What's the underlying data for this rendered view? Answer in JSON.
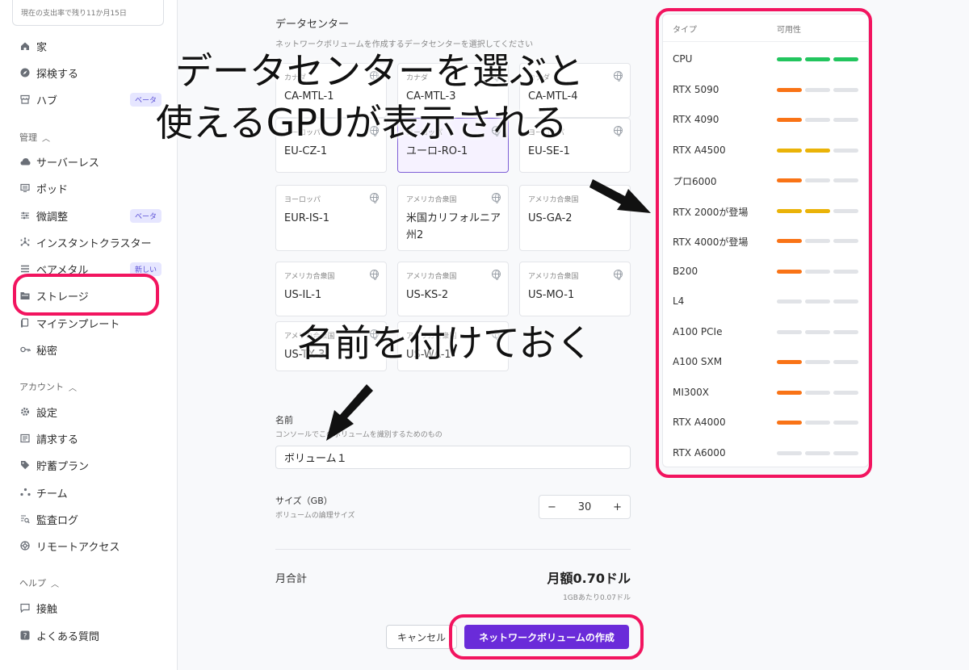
{
  "sidebar": {
    "spend_text": "現在の支出率で残り11か月15日",
    "items": [
      {
        "icon": "home-icon",
        "label": "家",
        "badge": ""
      },
      {
        "icon": "compass-icon",
        "label": "探検する",
        "badge": ""
      },
      {
        "icon": "store-icon",
        "label": "ハブ",
        "badge": "ベータ"
      },
      {
        "icon": "cloud-icon",
        "label": "サーバーレス",
        "badge": ""
      },
      {
        "icon": "monitor-icon",
        "label": "ポッド",
        "badge": ""
      },
      {
        "icon": "sliders-icon",
        "label": "微調整",
        "badge": "ベータ"
      },
      {
        "icon": "cluster-icon",
        "label": "インスタントクラスター",
        "badge": ""
      },
      {
        "icon": "list-icon",
        "label": "ベアメタル",
        "badge": "新しい"
      },
      {
        "icon": "folder-icon",
        "label": "ストレージ",
        "badge": ""
      },
      {
        "icon": "template-icon",
        "label": "マイテンプレート",
        "badge": ""
      },
      {
        "icon": "key-icon",
        "label": "秘密",
        "badge": ""
      },
      {
        "icon": "gear-icon",
        "label": "設定",
        "badge": ""
      },
      {
        "icon": "billing-icon",
        "label": "請求する",
        "badge": ""
      },
      {
        "icon": "tag-icon",
        "label": "貯蓄プラン",
        "badge": ""
      },
      {
        "icon": "team-icon",
        "label": "チーム",
        "badge": ""
      },
      {
        "icon": "audit-icon",
        "label": "監査ログ",
        "badge": ""
      },
      {
        "icon": "remote-icon",
        "label": "リモートアクセス",
        "badge": ""
      },
      {
        "icon": "chat-icon",
        "label": "接触",
        "badge": ""
      },
      {
        "icon": "question-icon",
        "label": "よくある質問",
        "badge": ""
      }
    ],
    "sections": [
      "管理",
      "アカウント",
      "ヘルプ"
    ]
  },
  "main": {
    "title": "データセンター",
    "subtitle": "ネットワークボリュームを作成するデータセンターを選択してください",
    "datacenters": [
      {
        "region": "カナダ",
        "code": "CA-MTL-1",
        "selected": false
      },
      {
        "region": "カナダ",
        "code": "CA-MTL-3",
        "selected": false
      },
      {
        "region": "カナダ",
        "code": "CA-MTL-4",
        "selected": false
      },
      {
        "region": "ヨーロッパ",
        "code": "EU-CZ-1",
        "selected": false
      },
      {
        "region": "ヨーロッパ",
        "code": "ユーロ-RO-1",
        "selected": true
      },
      {
        "region": "ヨーロッパ",
        "code": "EU-SE-1",
        "selected": false
      },
      {
        "region": "ヨーロッパ",
        "code": "EUR-IS-1",
        "selected": false
      },
      {
        "region": "アメリカ合衆国",
        "code": "米国カリフォルニア州2",
        "selected": false
      },
      {
        "region": "アメリカ合衆国",
        "code": "US-GA-2",
        "selected": false
      },
      {
        "region": "アメリカ合衆国",
        "code": "US-IL-1",
        "selected": false
      },
      {
        "region": "アメリカ合衆国",
        "code": "US-KS-2",
        "selected": false
      },
      {
        "region": "アメリカ合衆国",
        "code": "US-MO-1",
        "selected": false
      },
      {
        "region": "アメリカ合衆国",
        "code": "US-TX-3",
        "selected": false
      },
      {
        "region": "アメリカ合衆国",
        "code": "US-WA-1",
        "selected": false
      }
    ],
    "name_label": "名前",
    "name_hint": "コンソールでこのボリュームを識別するためのもの",
    "name_value": "ボリューム１",
    "size_label": "サイズ（GB）",
    "size_hint": "ボリュームの論理サイズ",
    "size_value": "30",
    "total_label": "月合計",
    "total_value": "月額0.70ドル",
    "total_sub": "1GBあたり0.07ドル",
    "cancel_label": "キャンセル",
    "create_label": "ネットワークボリュームの作成"
  },
  "gpu_panel": {
    "col_type": "タイプ",
    "col_availability": "可用性",
    "colors": {
      "high": "#22c55e",
      "medium": "#eab308",
      "low": "#f97316",
      "none": "#e1e3e7"
    },
    "rows": [
      {
        "name": "CPU",
        "level": "high",
        "bars": 3
      },
      {
        "name": "RTX 5090",
        "level": "low",
        "bars": 1
      },
      {
        "name": "RTX 4090",
        "level": "low",
        "bars": 1
      },
      {
        "name": "RTX A4500",
        "level": "medium",
        "bars": 2
      },
      {
        "name": "プロ6000",
        "level": "low",
        "bars": 1
      },
      {
        "name": "RTX 2000が登場",
        "level": "medium",
        "bars": 2
      },
      {
        "name": "RTX 4000が登場",
        "level": "low",
        "bars": 1
      },
      {
        "name": "B200",
        "level": "low",
        "bars": 1
      },
      {
        "name": "L4",
        "level": "none",
        "bars": 0
      },
      {
        "name": "A100 PCIe",
        "level": "none",
        "bars": 0
      },
      {
        "name": "A100 SXM",
        "level": "low",
        "bars": 1
      },
      {
        "name": "MI300X",
        "level": "low",
        "bars": 1
      },
      {
        "name": "RTX A4000",
        "level": "low",
        "bars": 1
      },
      {
        "name": "RTX A6000",
        "level": "none",
        "bars": 0
      }
    ]
  },
  "annotations": {
    "line1": "データセンターを選ぶと",
    "line2": "使えるGPUが表示される",
    "line3": "名前を付けておく",
    "highlight_color": "#f2145f"
  }
}
